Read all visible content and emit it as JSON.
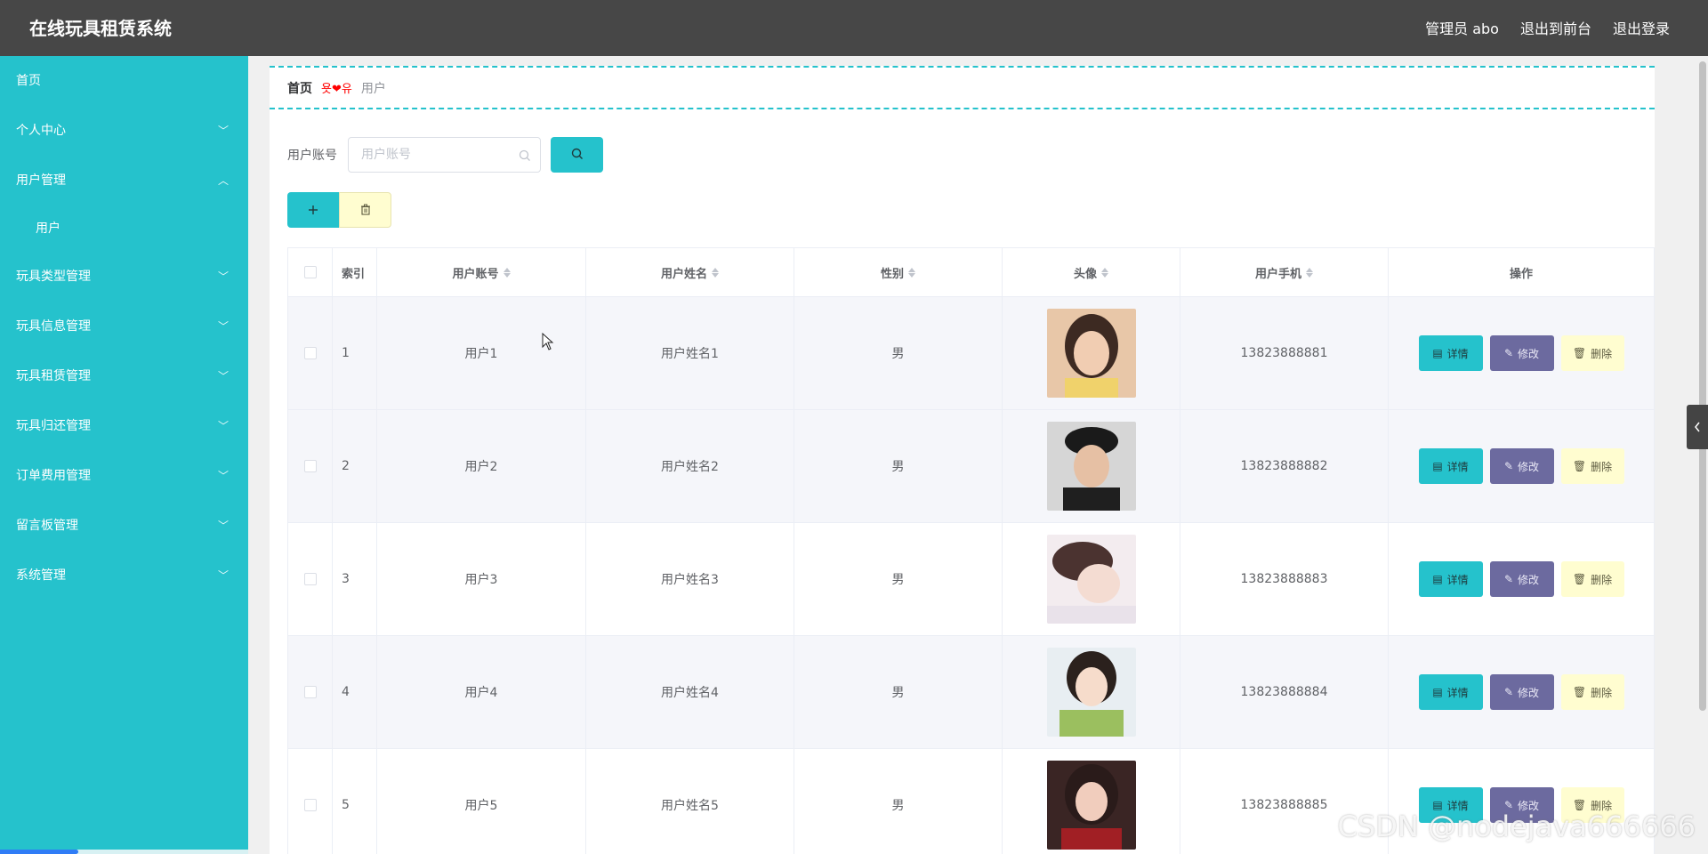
{
  "app": {
    "title": "在线玩具租赁系统",
    "links": [
      "管理员 abo",
      "退出到前台",
      "退出登录"
    ]
  },
  "sidebar": {
    "items": [
      {
        "label": "首页",
        "chevron": ""
      },
      {
        "label": "个人中心",
        "chevron": "﹀"
      },
      {
        "label": "用户管理",
        "chevron": "︿"
      },
      {
        "label": "用户",
        "chevron": ""
      },
      {
        "label": "玩具类型管理",
        "chevron": "﹀"
      },
      {
        "label": "玩具信息管理",
        "chevron": "﹀"
      },
      {
        "label": "玩具租赁管理",
        "chevron": "﹀"
      },
      {
        "label": "玩具归还管理",
        "chevron": "﹀"
      },
      {
        "label": "订单费用管理",
        "chevron": "﹀"
      },
      {
        "label": "留言板管理",
        "chevron": "﹀"
      },
      {
        "label": "系统管理",
        "chevron": "﹀"
      }
    ]
  },
  "breadcrumb": {
    "home": "首页",
    "separator": "욧❤유",
    "current": "用户"
  },
  "search": {
    "label": "用户账号",
    "placeholder": "用户账号"
  },
  "table": {
    "headers": {
      "index": "索引",
      "account": "用户账号",
      "name": "用户姓名",
      "gender": "性别",
      "avatar": "头像",
      "phone": "用户手机",
      "ops": "操作"
    },
    "rows": [
      {
        "index": "1",
        "account": "用户1",
        "name": "用户姓名1",
        "gender": "男",
        "phone": "13823888881",
        "avatar_color": "#d9a383"
      },
      {
        "index": "2",
        "account": "用户2",
        "name": "用户姓名2",
        "gender": "男",
        "phone": "13823888882",
        "avatar_color": "#2a2a2a"
      },
      {
        "index": "3",
        "account": "用户3",
        "name": "用户姓名3",
        "gender": "男",
        "phone": "13823888883",
        "avatar_color": "#e7d2d0"
      },
      {
        "index": "4",
        "account": "用户4",
        "name": "用户姓名4",
        "gender": "男",
        "phone": "13823888884",
        "avatar_color": "#9bbf5f"
      },
      {
        "index": "5",
        "account": "用户5",
        "name": "用户姓名5",
        "gender": "男",
        "phone": "13823888885",
        "avatar_color": "#5a2a28"
      }
    ],
    "buttons": {
      "detail": "详情",
      "edit": "修改",
      "delete": "删除"
    }
  },
  "watermark": "CSDN @nodejava666666",
  "colors": {
    "primary": "#25c2cc",
    "topbar": "#474747",
    "edit": "#6c6a9f",
    "delete": "#fffdd0"
  }
}
